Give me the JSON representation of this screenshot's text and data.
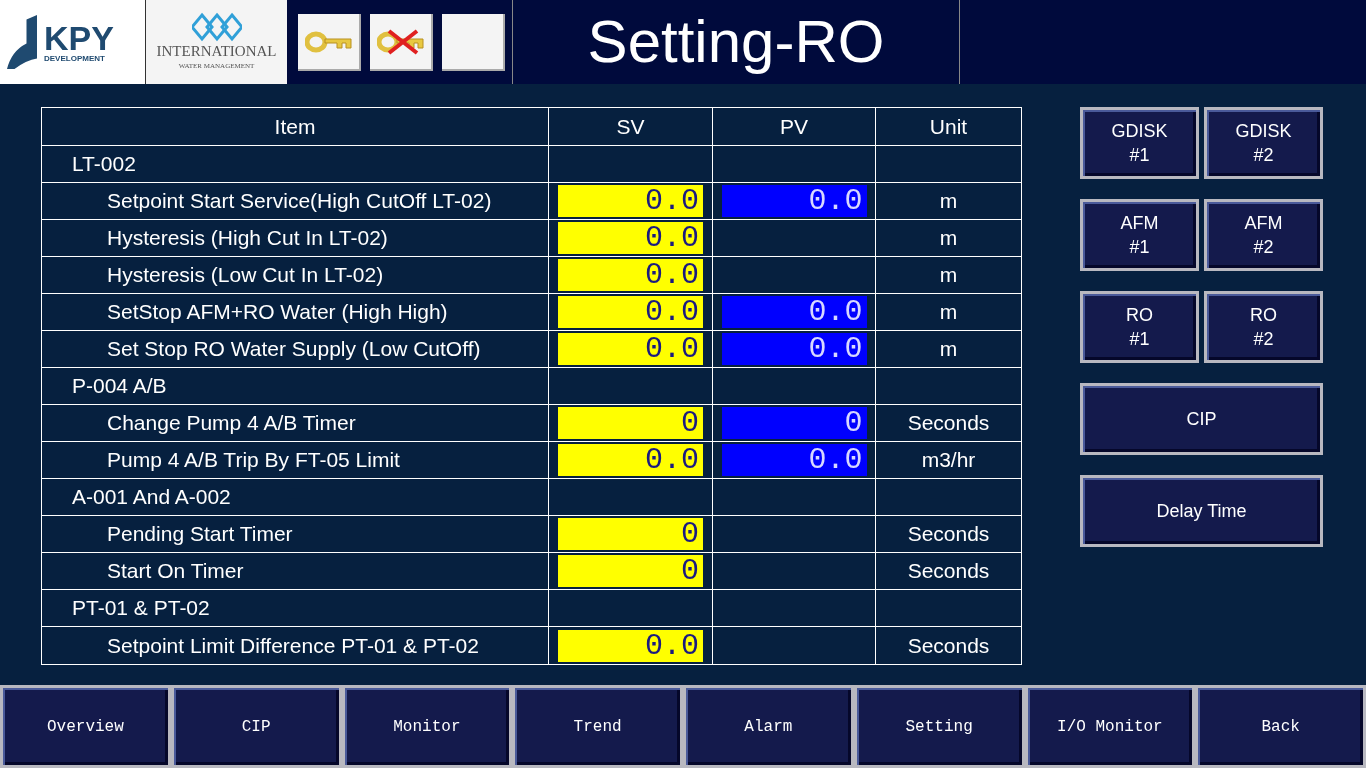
{
  "header": {
    "logo_1": {
      "name": "KPY",
      "subtitle": "DEVELOPMENT"
    },
    "logo_2": {
      "name": "INTERNATIONAL",
      "subtitle": "WATER MANAGEMENT"
    },
    "key_buttons": [
      {
        "kind": "key"
      },
      {
        "kind": "key-cancel"
      },
      {
        "kind": "blank"
      }
    ],
    "title": "Setting-RO"
  },
  "table": {
    "columns": [
      "Item",
      "SV",
      "PV",
      "Unit"
    ],
    "rows": [
      {
        "kind": "group",
        "item": "LT-002"
      },
      {
        "kind": "item",
        "item": "Setpoint Start Service(High CutOff LT-02)",
        "sv": "0.0",
        "pv": "0.0",
        "unit": "m"
      },
      {
        "kind": "item",
        "item": "Hysteresis (High Cut In LT-02)",
        "sv": "0.0",
        "unit": "m"
      },
      {
        "kind": "item",
        "item": "Hysteresis (Low Cut In LT-02)",
        "sv": "0.0",
        "unit": "m"
      },
      {
        "kind": "item",
        "item": "SetStop AFM+RO Water (High High)",
        "sv": "0.0",
        "pv": "0.0",
        "unit": "m"
      },
      {
        "kind": "item",
        "item": "Set Stop RO Water Supply (Low CutOff)",
        "sv": "0.0",
        "pv": "0.0",
        "unit": "m"
      },
      {
        "kind": "group",
        "item": "P-004 A/B"
      },
      {
        "kind": "item",
        "item": "Change Pump 4 A/B Timer",
        "sv": "0",
        "pv": "0",
        "unit": "Seconds"
      },
      {
        "kind": "item",
        "item": "Pump 4 A/B Trip By FT-05 Limit",
        "sv": "0.0",
        "pv": "0.0",
        "unit": "m3/hr"
      },
      {
        "kind": "group",
        "item": "A-001 And A-002"
      },
      {
        "kind": "item",
        "item": "Pending Start Timer",
        "sv": "0",
        "unit": "Seconds"
      },
      {
        "kind": "item",
        "item": "Start On Timer",
        "sv": "0",
        "unit": "Seconds"
      },
      {
        "kind": "group",
        "item": "PT-01 & PT-02"
      },
      {
        "kind": "item",
        "item": "Setpoint Limit Difference PT-01 & PT-02",
        "sv": "0.0",
        "unit": "Seconds"
      }
    ]
  },
  "side_buttons": [
    {
      "kind": "half",
      "lines": [
        "GDISK",
        "#1"
      ]
    },
    {
      "kind": "half",
      "lines": [
        "GDISK",
        "#2"
      ]
    },
    {
      "kind": "half",
      "lines": [
        "AFM",
        "#1"
      ]
    },
    {
      "kind": "half",
      "lines": [
        "AFM",
        "#2"
      ]
    },
    {
      "kind": "half",
      "lines": [
        "RO",
        "#1"
      ]
    },
    {
      "kind": "half",
      "lines": [
        "RO",
        "#2"
      ]
    },
    {
      "kind": "full",
      "lines": [
        "CIP"
      ]
    },
    {
      "kind": "full",
      "lines": [
        "Delay Time"
      ]
    }
  ],
  "nav": [
    "Overview",
    "CIP",
    "Monitor",
    "Trend",
    "Alarm",
    "Setting",
    "I/O Monitor",
    "Back"
  ]
}
